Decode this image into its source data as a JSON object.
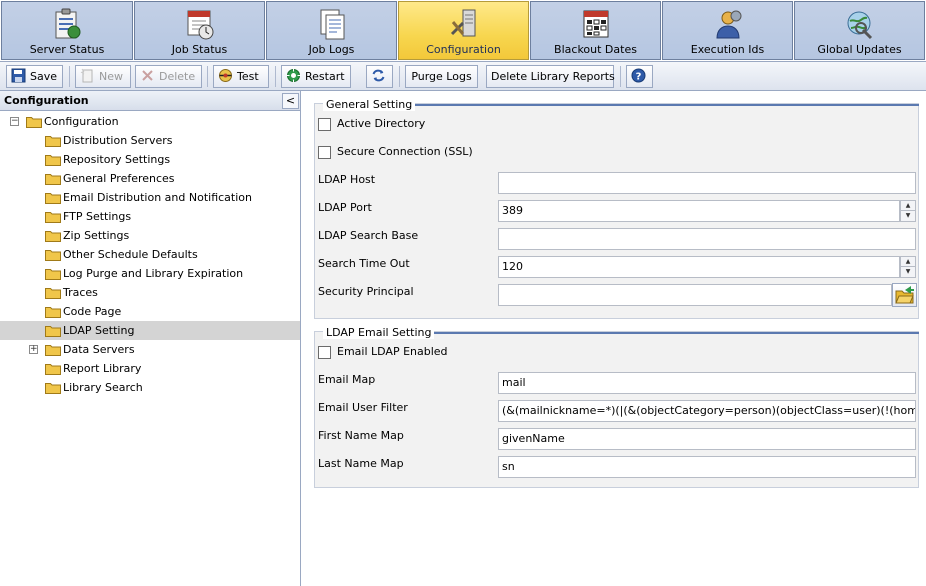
{
  "tabs": [
    {
      "label": "Server Status",
      "icon": "server-status-icon",
      "active": false
    },
    {
      "label": "Job Status",
      "icon": "job-status-icon",
      "active": false
    },
    {
      "label": "Job Logs",
      "icon": "job-logs-icon",
      "active": false
    },
    {
      "label": "Configuration",
      "icon": "configuration-icon",
      "active": true
    },
    {
      "label": "Blackout Dates",
      "icon": "calendar-icon",
      "active": false
    },
    {
      "label": "Execution Ids",
      "icon": "execution-ids-icon",
      "active": false
    },
    {
      "label": "Global Updates",
      "icon": "global-updates-icon",
      "active": false
    }
  ],
  "toolbar": {
    "save": "Save",
    "new": "New",
    "delete": "Delete",
    "test": "Test",
    "restart": "Restart",
    "purge_logs": "Purge Logs",
    "delete_library_reports": "Delete Library Reports"
  },
  "left_panel": {
    "title": "Configuration",
    "collapse": "<",
    "tree": {
      "root": "Configuration",
      "items": [
        "Distribution Servers",
        "Repository Settings",
        "General Preferences",
        "Email Distribution and Notification",
        "FTP Settings",
        "Zip Settings",
        "Other Schedule Defaults",
        "Log Purge and Library Expiration",
        "Traces",
        "Code Page",
        "LDAP Setting",
        "Data Servers",
        "Report Library",
        "Library Search"
      ],
      "selected": "LDAP Setting"
    }
  },
  "general_setting": {
    "legend": "General Setting",
    "active_directory": {
      "label": "Active Directory",
      "checked": false
    },
    "secure_connection": {
      "label": "Secure Connection (SSL)",
      "checked": false
    },
    "ldap_host": {
      "label": "LDAP Host",
      "value": ""
    },
    "ldap_port": {
      "label": "LDAP Port",
      "value": "389"
    },
    "ldap_search_base": {
      "label": "LDAP Search Base",
      "value": ""
    },
    "search_time_out": {
      "label": "Search Time Out",
      "value": "120"
    },
    "security_principal": {
      "label": "Security Principal",
      "value": ""
    }
  },
  "ldap_email_setting": {
    "legend": "LDAP Email Setting",
    "email_ldap_enabled": {
      "label": "Email LDAP Enabled",
      "checked": false
    },
    "email_map": {
      "label": "Email Map",
      "value": "mail"
    },
    "email_user_filter": {
      "label": "Email User Filter",
      "value": "(&(mailnickname=*)(|(&(objectCategory=person)(objectClass=user)(!(homeMDB=*)"
    },
    "first_name_map": {
      "label": "First Name Map",
      "value": "givenName"
    },
    "last_name_map": {
      "label": "Last Name Map",
      "value": "sn"
    }
  },
  "colors": {
    "tab_bg": "#b5c6e1",
    "tab_active_bg": "#f7d64e",
    "section_bg": "#f2f2f2",
    "legend_line": "#5b79b0",
    "folder": "#f0c64a",
    "selected_row": "#d4d4d4"
  }
}
